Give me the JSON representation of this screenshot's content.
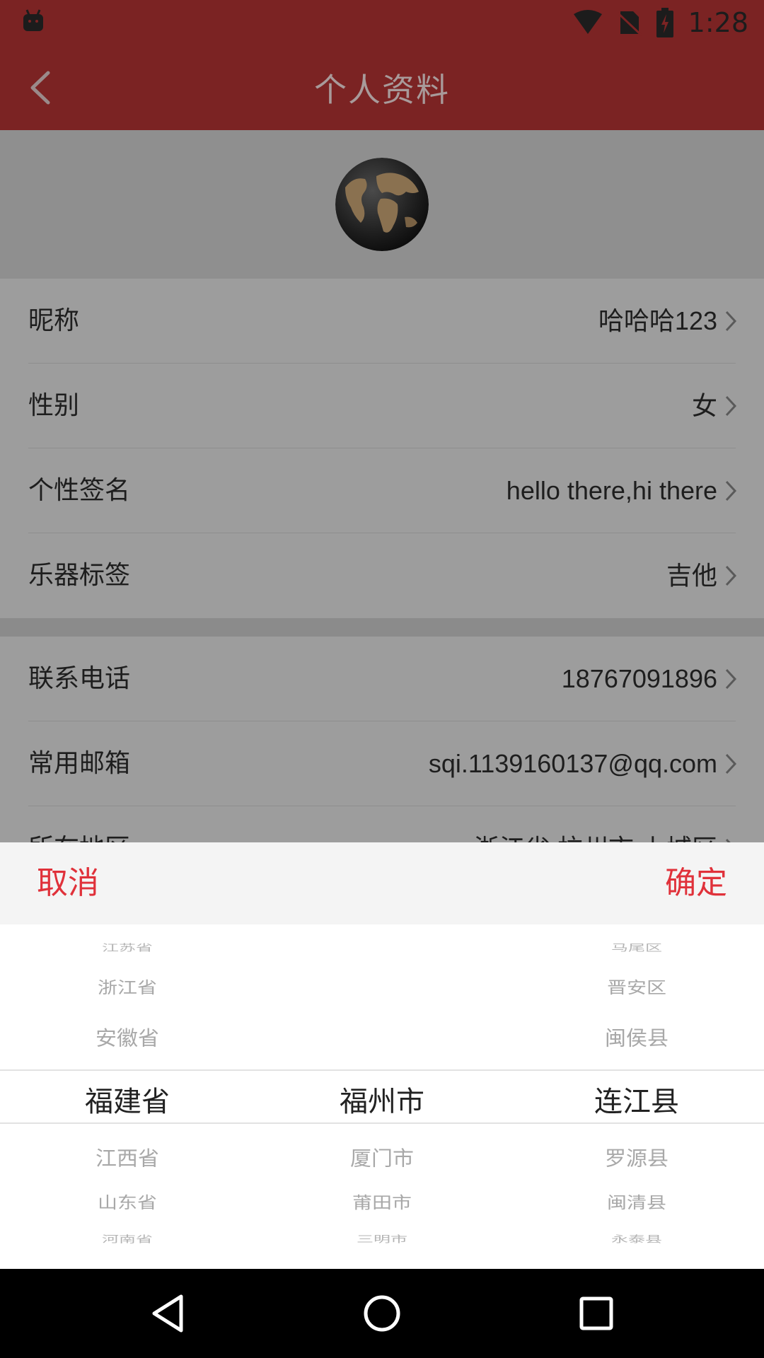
{
  "status_bar": {
    "time": "1:28"
  },
  "header": {
    "title": "个人资料"
  },
  "profile_group_1": [
    {
      "label": "昵称",
      "value": "哈哈哈123"
    },
    {
      "label": "性别",
      "value": "女"
    },
    {
      "label": "个性签名",
      "value": "hello there,hi there"
    },
    {
      "label": "乐器标签",
      "value": "吉他"
    }
  ],
  "profile_group_2": [
    {
      "label": "联系电话",
      "value": "18767091896"
    },
    {
      "label": "常用邮箱",
      "value": "sqi.1139160137@qq.com"
    },
    {
      "label": "所在地区",
      "value": "浙江省 杭州市 上城区"
    }
  ],
  "picker": {
    "cancel_label": "取消",
    "confirm_label": "确定",
    "province": {
      "above": [
        "江苏省",
        "浙江省",
        "安徽省"
      ],
      "selected": "福建省",
      "below": [
        "江西省",
        "山东省",
        "河南省"
      ]
    },
    "city": {
      "above": [],
      "selected": "福州市",
      "below": [
        "厦门市",
        "莆田市",
        "三明市"
      ]
    },
    "district": {
      "above": [
        "马尾区",
        "晋安区",
        "闽侯县"
      ],
      "selected": "连江县",
      "below": [
        "罗源县",
        "闽清县",
        "永泰县"
      ]
    }
  },
  "colors": {
    "primary": "#7b2323",
    "accent": "#e0313a",
    "overlay_bg": "#9d9d9d"
  }
}
